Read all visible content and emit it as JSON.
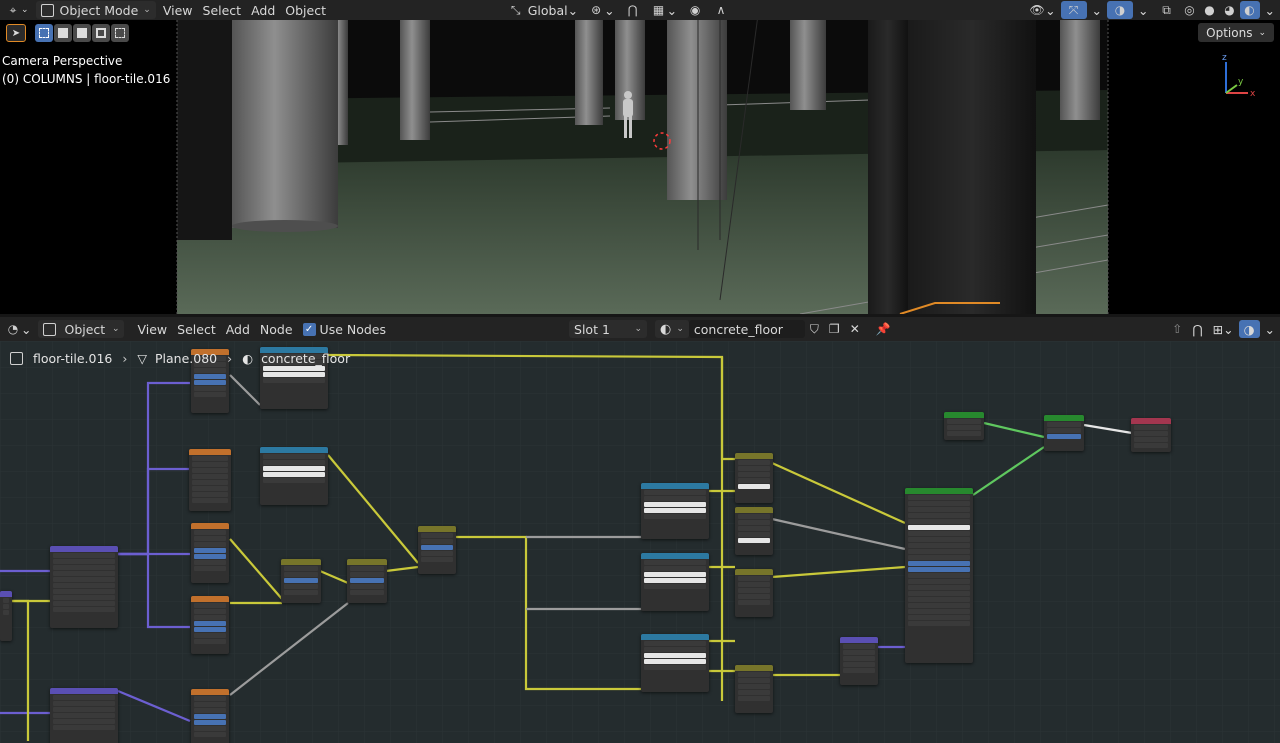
{
  "viewport_header": {
    "mode": "Object Mode",
    "menus": [
      "View",
      "Select",
      "Add",
      "Object"
    ],
    "transform_orientation": "Global"
  },
  "viewport": {
    "options_label": "Options",
    "overlay_line1": "Camera Perspective",
    "overlay_line2": "(0) COLUMNS | floor-tile.016"
  },
  "node_header": {
    "object_mode": "Object",
    "menus": [
      "View",
      "Select",
      "Add",
      "Node"
    ],
    "use_nodes_label": "Use Nodes",
    "use_nodes_checked": true,
    "slot": "Slot 1",
    "material_name": "concrete_floor"
  },
  "breadcrumb": {
    "object": "floor-tile.016",
    "mesh": "Plane.080",
    "material": "concrete_floor"
  },
  "colors": {
    "accent_blue": "#4772b3",
    "link_yellow": "#c9c93a",
    "link_purple": "#6c5fd1",
    "link_gray": "#9c9c9c",
    "link_green": "#5fc75f",
    "header_texture": "#c1702c",
    "header_color": "#2c79a1",
    "header_vector": "#5a4fb3",
    "header_shader": "#27892e",
    "header_mix": "#77752a",
    "header_output": "#a3364f"
  }
}
